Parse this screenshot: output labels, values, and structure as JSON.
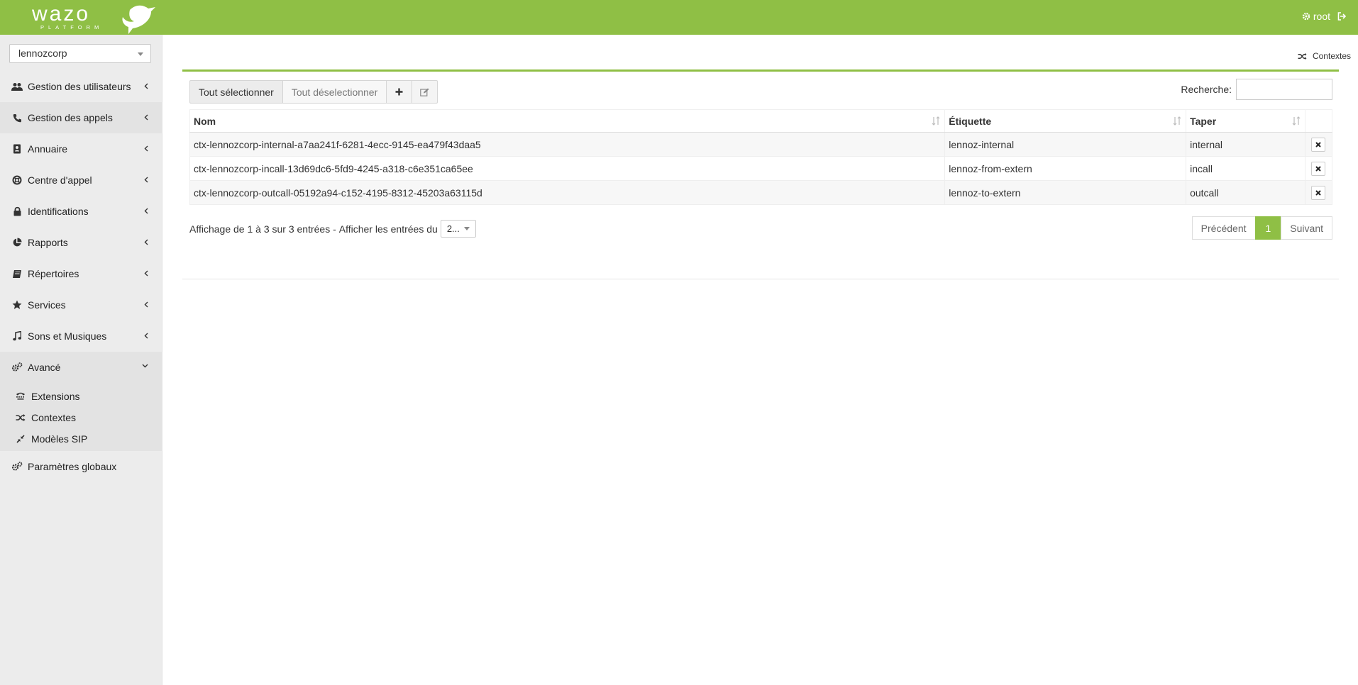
{
  "app": {
    "logo_word": "wazo",
    "logo_sub": "PLATFORM",
    "user": "root"
  },
  "colors": {
    "brand": "#8fbf45",
    "sidebar": "#ececec"
  },
  "sidebar": {
    "tenant_select": {
      "value": "lennozcorp"
    },
    "items": [
      {
        "label": "Gestion des utilisateurs",
        "icon": "users-icon"
      },
      {
        "label": "Gestion des appels",
        "icon": "phone-icon"
      },
      {
        "label": "Annuaire",
        "icon": "address-book-icon"
      },
      {
        "label": "Centre d'appel",
        "icon": "life-ring-icon"
      },
      {
        "label": "Identifications",
        "icon": "lock-icon"
      },
      {
        "label": "Rapports",
        "icon": "pie-chart-icon"
      },
      {
        "label": "Répertoires",
        "icon": "book-icon"
      },
      {
        "label": "Services",
        "icon": "star-icon"
      },
      {
        "label": "Sons et Musiques",
        "icon": "music-icon"
      },
      {
        "label": "Avancé",
        "icon": "cogs-icon"
      }
    ],
    "sub_items": [
      {
        "label": "Extensions",
        "icon": "tty-icon"
      },
      {
        "label": "Contextes",
        "icon": "random-icon"
      },
      {
        "label": "Modèles SIP",
        "icon": "compress-icon"
      }
    ],
    "bottom_item": {
      "label": "Paramètres globaux",
      "icon": "cogs-icon"
    }
  },
  "main": {
    "breadcrumb": "Contextes",
    "toolbar": {
      "select_all": "Tout sélectionner",
      "deselect_all": "Tout déselectionner"
    },
    "search": {
      "label": "Recherche:",
      "value": ""
    },
    "table": {
      "columns": [
        "Nom",
        "Étiquette",
        "Taper"
      ],
      "rows": [
        {
          "name": "ctx-lennozcorp-internal-a7aa241f-6281-4ecc-9145-ea479f43daa5",
          "label": "lennoz-internal",
          "type": "internal"
        },
        {
          "name": "ctx-lennozcorp-incall-13d69dc6-5fd9-4245-a318-c6e351ca65ee",
          "label": "lennoz-from-extern",
          "type": "incall"
        },
        {
          "name": "ctx-lennozcorp-outcall-05192a94-c152-4195-8312-45203a63115d",
          "label": "lennoz-to-extern",
          "type": "outcall"
        }
      ]
    },
    "info": {
      "text": "Affichage de 1 à 3 sur 3 entrées -",
      "length_label": "Afficher les entrées du",
      "length_value": "2..."
    },
    "pager": {
      "prev": "Précédent",
      "page": "1",
      "next": "Suivant"
    }
  }
}
